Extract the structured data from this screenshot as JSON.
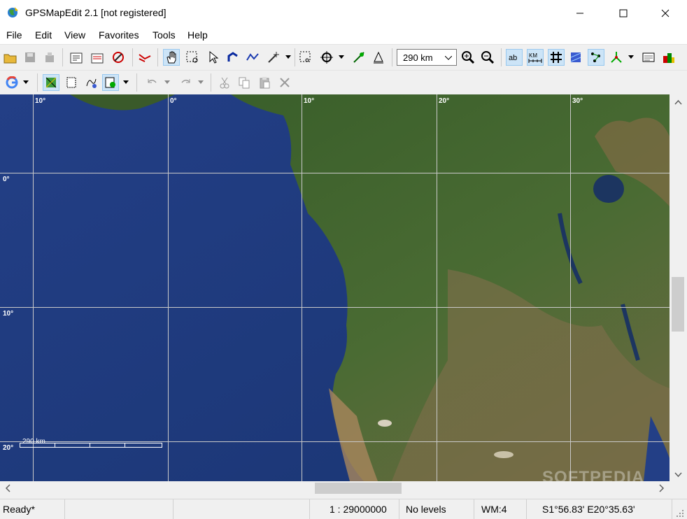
{
  "window": {
    "title": "GPSMapEdit 2.1 [not registered]"
  },
  "menu": [
    "File",
    "Edit",
    "View",
    "Favorites",
    "Tools",
    "Help"
  ],
  "toolbar": {
    "zoom_value": "290 km"
  },
  "map": {
    "grid_labels_top": [
      "10°",
      "0°",
      "10°",
      "20°",
      "30°"
    ],
    "grid_labels_left": [
      "0°",
      "10°",
      "20°"
    ],
    "scale_label": "290 km"
  },
  "status": {
    "state": "Ready*",
    "scale": "1 : 29000000",
    "levels": "No levels",
    "wm": "WM:4",
    "coords": "S1°56.83' E20°35.63'"
  },
  "watermark": "SOFTPEDIA",
  "colors": {
    "ocean": "#1d3a7a",
    "land": "#3c5e2c",
    "desert": "#a7865d",
    "grid": "#c9c9c9",
    "accent": "#cce4f7"
  }
}
